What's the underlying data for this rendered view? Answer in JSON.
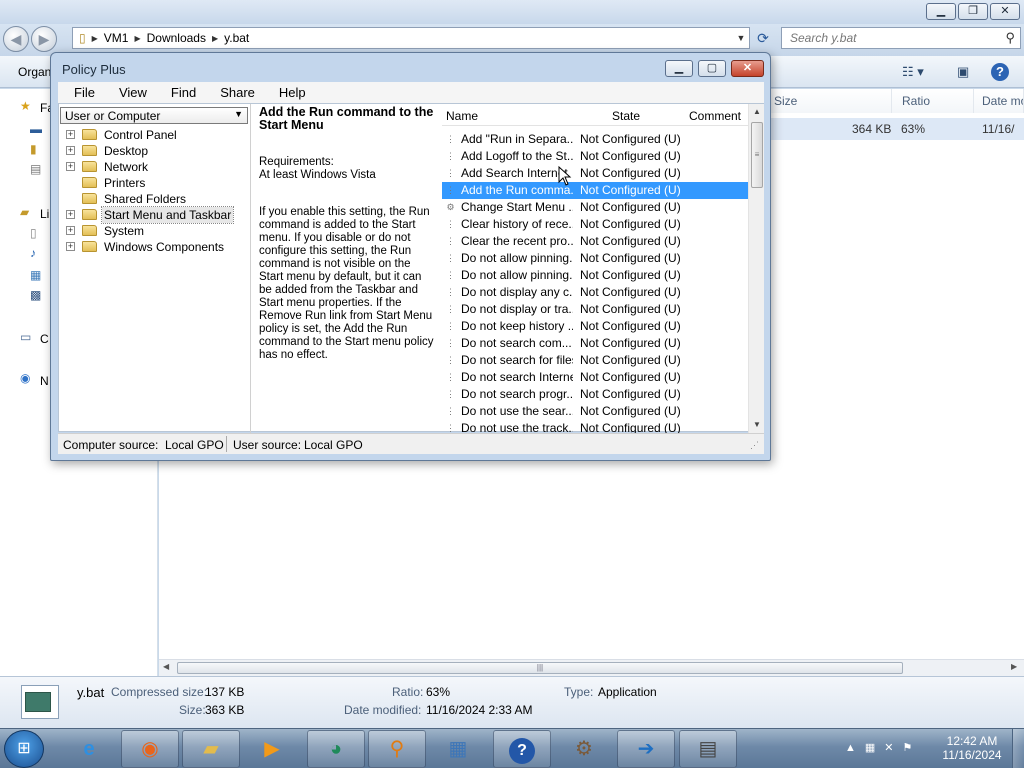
{
  "explorer": {
    "address": {
      "segments": [
        "VM1",
        "Downloads",
        "y.bat"
      ]
    },
    "search_placeholder": "Search y.bat",
    "toolbar": {
      "organize": "Organ"
    },
    "nav_partial": [
      "Fa",
      "Li",
      "C",
      "N"
    ],
    "columns": [
      "Size",
      "Ratio",
      "Date mo"
    ],
    "row": {
      "size": "364 KB",
      "ratio": "63%",
      "date": "11/16/"
    },
    "details": {
      "filename": "y.bat",
      "compressed_label": "Compressed size:",
      "compressed_value": "137 KB",
      "size_label": "Size:",
      "size_value": "363 KB",
      "ratio_label": "Ratio:",
      "ratio_value": "63%",
      "modified_label": "Date modified:",
      "modified_value": "11/16/2024 2:33 AM",
      "type_label": "Type:",
      "type_value": "Application"
    }
  },
  "policy_plus": {
    "title": "Policy Plus",
    "menu": [
      "File",
      "View",
      "Find",
      "Share",
      "Help"
    ],
    "scope_select": "User or Computer",
    "tree": [
      {
        "label": "Control Panel",
        "expander": true
      },
      {
        "label": "Desktop",
        "expander": true
      },
      {
        "label": "Network",
        "expander": true
      },
      {
        "label": "Printers",
        "expander": false
      },
      {
        "label": "Shared Folders",
        "expander": false
      },
      {
        "label": "Start Menu and Taskbar",
        "expander": true,
        "selected": true
      },
      {
        "label": "System",
        "expander": true
      },
      {
        "label": "Windows Components",
        "expander": true
      }
    ],
    "description": {
      "title": "Add the Run command to the Start Menu",
      "requirements_label": "Requirements:",
      "requirements_value": "At least Windows Vista",
      "text": "If you enable this setting, the Run command is added to the Start menu.  If you disable or do not configure this setting, the Run command is not visible on the Start menu by default, but it can be added from the Taskbar and Start menu properties. If the Remove Run link from Start Menu policy is set, the Add the Run command to the Start menu policy has no effect."
    },
    "list_headers": [
      "Name",
      "State",
      "Comment"
    ],
    "rows": [
      {
        "name": "Add \"Run in Separa...",
        "state": "Not Configured (U)"
      },
      {
        "name": "Add Logoff to the St...",
        "state": "Not Configured (U)"
      },
      {
        "name": "Add Search Internet",
        "state": "Not Configured (U)"
      },
      {
        "name": "Add the Run comma...",
        "state": "Not Configured (U)",
        "selected": true
      },
      {
        "name": "Change Start Menu ...",
        "state": "Not Configured (U)",
        "gear": true
      },
      {
        "name": "Clear history of rece...",
        "state": "Not Configured (U)"
      },
      {
        "name": "Clear the recent pro...",
        "state": "Not Configured (U)"
      },
      {
        "name": "Do not allow pinning...",
        "state": "Not Configured (U)"
      },
      {
        "name": "Do not allow pinning...",
        "state": "Not Configured (U)"
      },
      {
        "name": "Do not display any c...",
        "state": "Not Configured (U)"
      },
      {
        "name": "Do not display or tra...",
        "state": "Not Configured (U)"
      },
      {
        "name": "Do not keep history ...",
        "state": "Not Configured (U)"
      },
      {
        "name": "Do not search com...",
        "state": "Not Configured (U)"
      },
      {
        "name": "Do not search for files",
        "state": "Not Configured (U)"
      },
      {
        "name": "Do not search Internet",
        "state": "Not Configured (U)"
      },
      {
        "name": "Do not search progr...",
        "state": "Not Configured (U)"
      },
      {
        "name": "Do not use the sear...",
        "state": "Not Configured (U)"
      },
      {
        "name": "Do not use the track...",
        "state": "Not Configured (U)"
      }
    ],
    "status": {
      "computer_label": "Computer source:",
      "computer_value": "Local GPO",
      "user_label": "User source:",
      "user_value": "Local GPO"
    }
  },
  "taskbar": {
    "clock_time": "12:42 AM",
    "clock_date": "11/16/2024"
  },
  "colors": {
    "selection": "#3399ff",
    "taskbar": "#6e89a8"
  }
}
